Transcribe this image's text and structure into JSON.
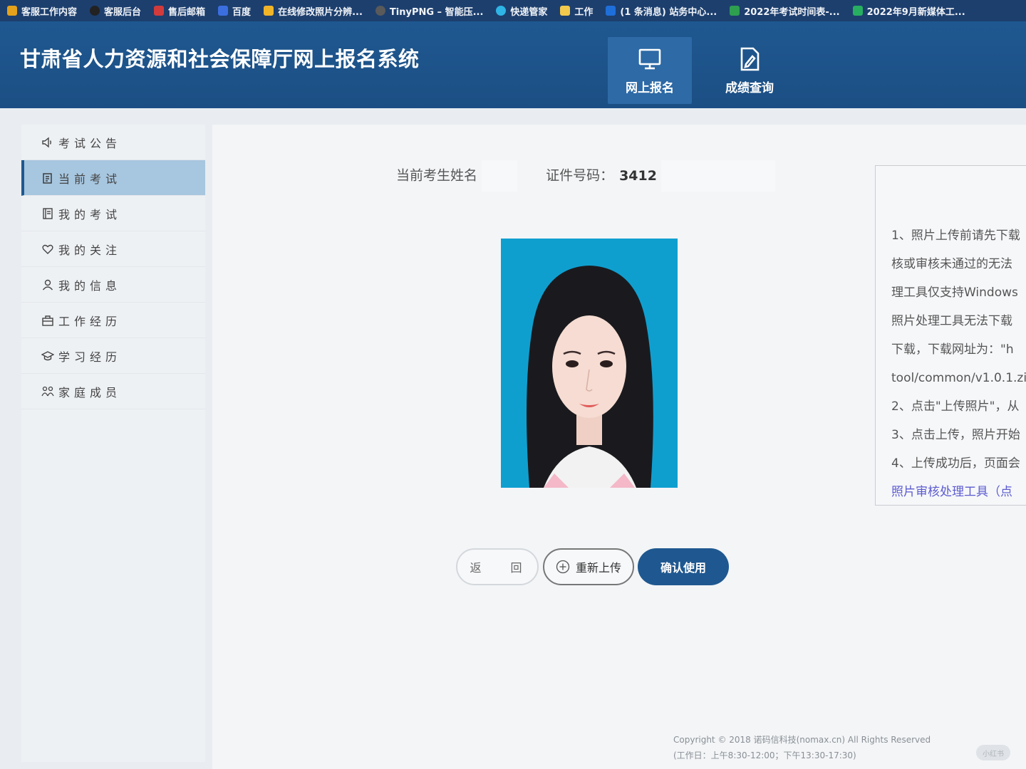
{
  "bookmarks": [
    {
      "label": "客服工作内容",
      "color": "#e4a11b"
    },
    {
      "label": "客服后台",
      "color": "#222222"
    },
    {
      "label": "售后邮箱",
      "color": "#d23b3b"
    },
    {
      "label": "百度",
      "color": "#3b6fe0"
    },
    {
      "label": "在线修改照片分辨...",
      "color": "#f0b429"
    },
    {
      "label": "TinyPNG – 智能压...",
      "color": "#5a5a5a"
    },
    {
      "label": "快递管家",
      "color": "#2eb5e6"
    },
    {
      "label": "工作",
      "color": "#f2c94c"
    },
    {
      "label": "(1 条消息) 站务中心...",
      "color": "#1e6fd9"
    },
    {
      "label": "2022年考试时间表-...",
      "color": "#2e9e4f"
    },
    {
      "label": "2022年9月新媒体工...",
      "color": "#27ae60"
    }
  ],
  "header": {
    "title": "甘肃省人力资源和社会保障厅网上报名系统",
    "nav": [
      {
        "label": "网上报名",
        "icon": "monitor-icon",
        "active": true
      },
      {
        "label": "成绩查询",
        "icon": "document-edit-icon",
        "active": false
      }
    ]
  },
  "sidebar": {
    "items": [
      {
        "label": "考试公告",
        "icon": "speaker-icon"
      },
      {
        "label": "当前考试",
        "icon": "clipboard-icon",
        "active": true
      },
      {
        "label": "我的考试",
        "icon": "notebook-icon"
      },
      {
        "label": "我的关注",
        "icon": "heart-icon"
      },
      {
        "label": "我的信息",
        "icon": "user-icon"
      },
      {
        "label": "工作经历",
        "icon": "briefcase-icon"
      },
      {
        "label": "学习经历",
        "icon": "graduation-cap-icon"
      },
      {
        "label": "家庭成员",
        "icon": "family-icon"
      }
    ]
  },
  "main": {
    "candidate_name_label": "当前考生姓名",
    "id_label": "证件号码：",
    "id_value": "3412",
    "buttons": {
      "back": "返 回",
      "reupload": "重新上传",
      "confirm": "确认使用"
    },
    "instructions": [
      "1、照片上传前请先下载",
      "核或审核未通过的无法",
      "理工具仅支持Windows",
      "照片处理工具无法下载",
      "下载，下载网址为：\"h",
      "tool/common/v1.0.1.zi",
      "2、点击\"上传照片\"，从",
      "3、点击上传，照片开始",
      "4、上传成功后，页面会"
    ],
    "instructions_link": "照片审核处理工具（点"
  },
  "footer": {
    "copyright": "Copyright © 2018 诺码信科技(nomax.cn) All Rights Reserved",
    "hours": "(工作日：上午8:30-12:00；下午13:30-17:30)"
  },
  "corner_badge": "小红书"
}
